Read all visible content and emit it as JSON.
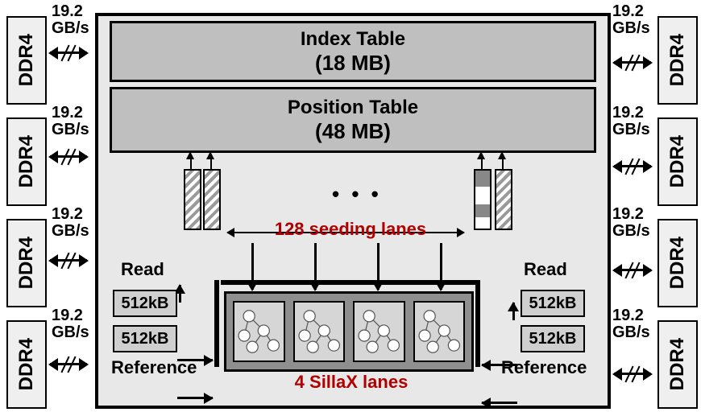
{
  "ddr": {
    "label": "DDR4",
    "bandwidth_value": "19.2",
    "bandwidth_unit": "GB/s"
  },
  "index_table": {
    "title": "Index Table",
    "size": "(18 MB)"
  },
  "position_table": {
    "title": "Position Table",
    "size": "(48 MB)"
  },
  "seeding": {
    "count": 128,
    "label": "128 seeding lanes",
    "ellipsis": "• • •"
  },
  "read_label": "Read",
  "reference_label": "Reference",
  "buffer_size": "512kB",
  "sillax": {
    "count": 4,
    "label": "4 SillaX lanes"
  }
}
